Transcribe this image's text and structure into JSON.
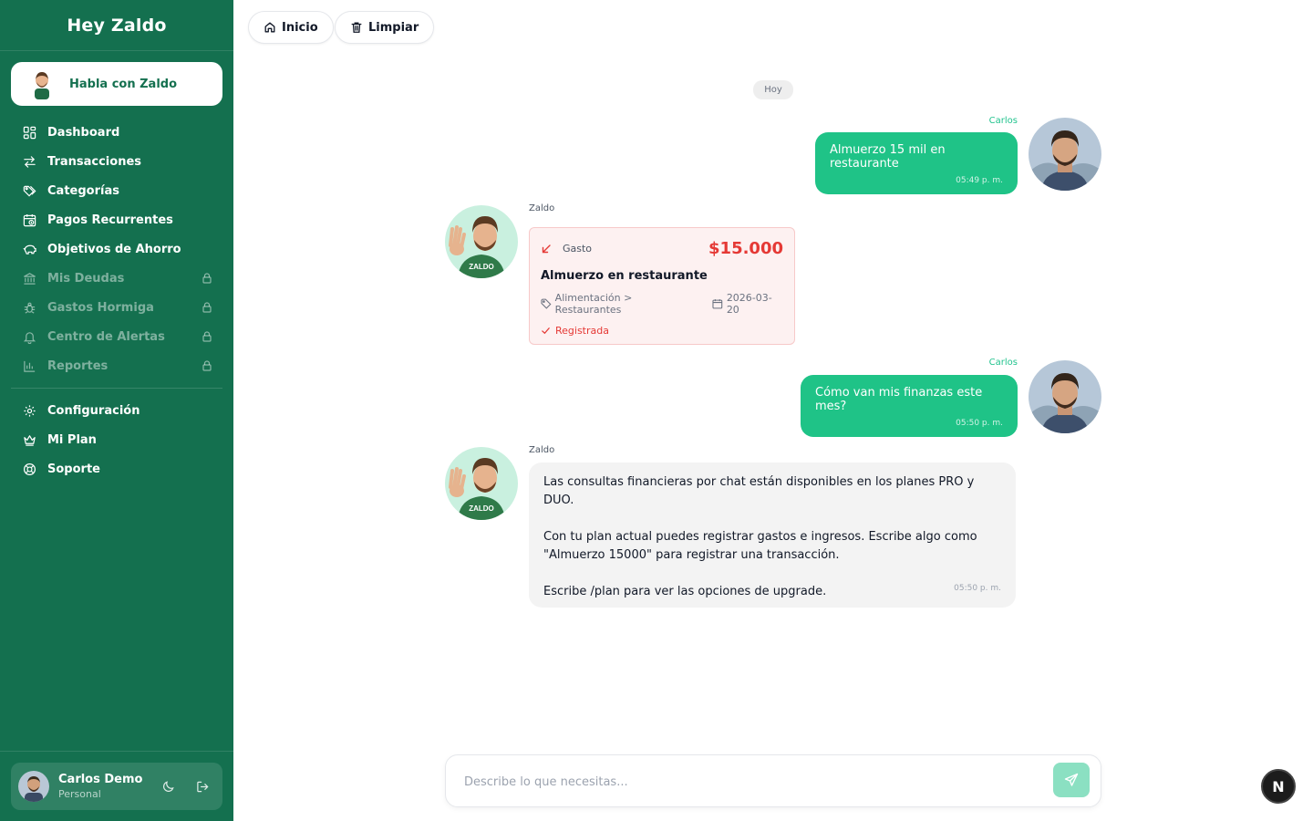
{
  "sidebar": {
    "brand": "Hey Zaldo",
    "cta_label": "Habla con Zaldo",
    "items": [
      {
        "label": "Dashboard",
        "icon": "grid-icon",
        "locked": false
      },
      {
        "label": "Transacciones",
        "icon": "arrows-exchange-icon",
        "locked": false
      },
      {
        "label": "Categorías",
        "icon": "tags-icon",
        "locked": false
      },
      {
        "label": "Pagos Recurrentes",
        "icon": "calendar-clock-icon",
        "locked": false
      },
      {
        "label": "Objetivos de Ahorro",
        "icon": "piggy-bank-icon",
        "locked": false
      },
      {
        "label": "Mis Deudas",
        "icon": "bank-icon",
        "locked": true
      },
      {
        "label": "Gastos Hormiga",
        "icon": "bug-icon",
        "locked": true
      },
      {
        "label": "Centro de Alertas",
        "icon": "bell-icon",
        "locked": true
      },
      {
        "label": "Reportes",
        "icon": "bar-chart-icon",
        "locked": true
      }
    ],
    "secondary_items": [
      {
        "label": "Configuración",
        "icon": "gear-icon"
      },
      {
        "label": "Mi Plan",
        "icon": "crown-icon"
      },
      {
        "label": "Soporte",
        "icon": "lifebuoy-icon"
      }
    ],
    "user": {
      "name": "Carlos Demo",
      "plan": "Personal"
    }
  },
  "toolbar": {
    "home_label": "Inicio",
    "clear_label": "Limpiar"
  },
  "chat": {
    "day_label": "Hoy",
    "messages": [
      {
        "sender": "Carlos",
        "text": "Almuerzo 15 mil en restaurante",
        "time": "05:49 p. m."
      },
      {
        "sender": "Zaldo",
        "card": {
          "kind": "Gasto",
          "amount": "$15.000",
          "description": "Almuerzo en restaurante",
          "category": "Alimentación > Restaurantes",
          "date": "2026-03-20",
          "status": "Registrada"
        }
      },
      {
        "sender": "Carlos",
        "text": "Cómo van mis finanzas este mes?",
        "time": "05:50 p. m."
      },
      {
        "sender": "Zaldo",
        "paragraphs": [
          "Las consultas financieras por chat están disponibles en los planes PRO y DUO.",
          "Con tu plan actual puedes registrar gastos e ingresos. Escribe algo como \"Almuerzo 15000\" para registrar una transacción.",
          "Escribe /plan para ver las opciones de upgrade."
        ],
        "time": "05:50 p. m."
      }
    ]
  },
  "composer": {
    "placeholder": "Describe lo que necesitas..."
  },
  "badge": {
    "letter": "N"
  },
  "colors": {
    "sidebar": "#14704f",
    "accent": "#1fc387",
    "expense": "#e53935"
  }
}
